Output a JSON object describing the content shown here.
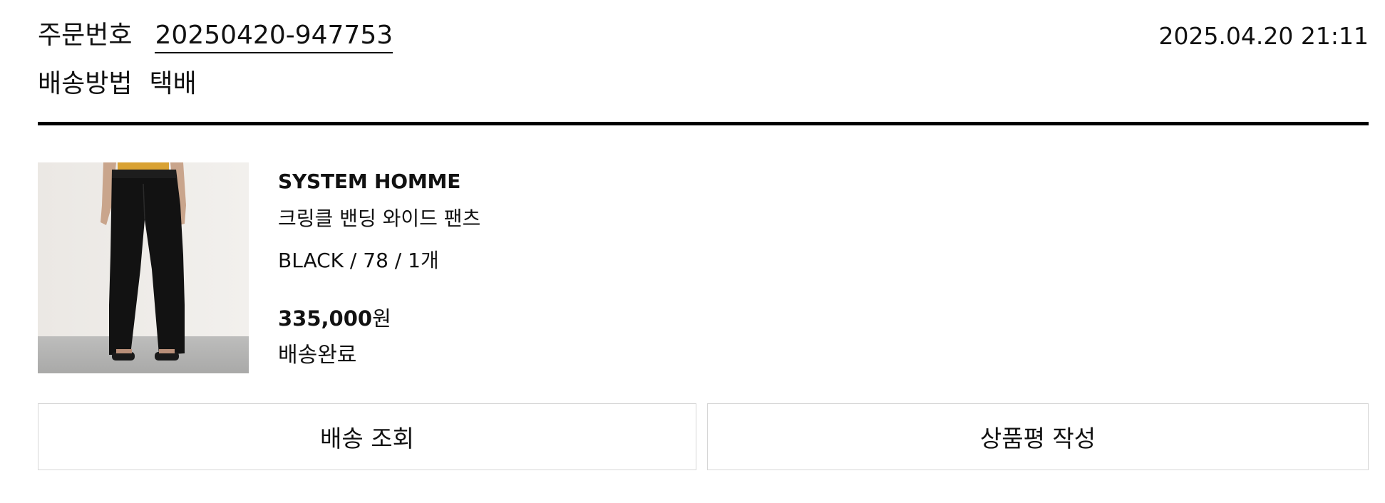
{
  "order": {
    "number_label": "주문번호",
    "number": "20250420-947753",
    "date": "2025.04.20 21:11",
    "shipping_label": "배송방법",
    "shipping_method": "택배"
  },
  "item": {
    "brand": "SYSTEM HOMME",
    "name": "크링클 밴딩 와이드 팬츠",
    "option": "BLACK  / 78  / 1개",
    "price_amount": "335,000",
    "price_unit": "원",
    "status": "배송완료"
  },
  "actions": {
    "track_label": "배송 조회",
    "review_label": "상품평 작성"
  }
}
